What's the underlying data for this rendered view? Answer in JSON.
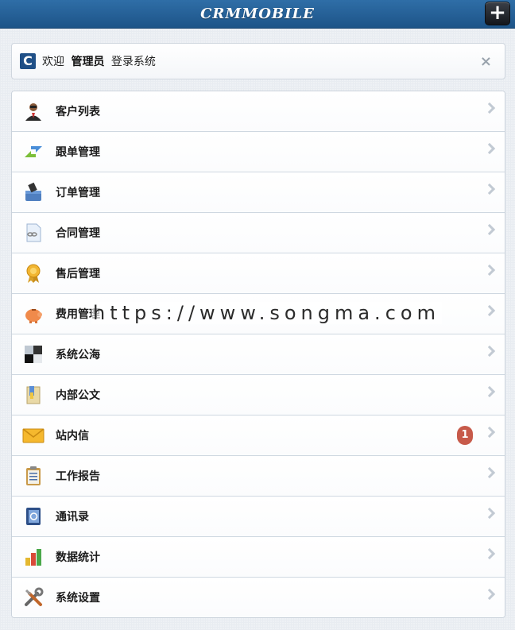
{
  "header": {
    "title": "CRMMOBILE",
    "add_label": "+"
  },
  "welcome": {
    "prefix": "欢迎",
    "role": "管理员",
    "suffix": "登录系统",
    "close": "×"
  },
  "menu": [
    {
      "label": "客户列表",
      "icon": "customer-icon"
    },
    {
      "label": "跟单管理",
      "icon": "follow-icon"
    },
    {
      "label": "订单管理",
      "icon": "order-icon"
    },
    {
      "label": "合同管理",
      "icon": "contract-icon"
    },
    {
      "label": "售后管理",
      "icon": "aftersale-icon"
    },
    {
      "label": "费用管理",
      "icon": "expense-icon"
    },
    {
      "label": "系统公海",
      "icon": "pool-icon"
    },
    {
      "label": "内部公文",
      "icon": "document-icon"
    },
    {
      "label": "站内信",
      "icon": "mail-icon",
      "badge": "1"
    },
    {
      "label": "工作报告",
      "icon": "report-icon"
    },
    {
      "label": "通讯录",
      "icon": "contacts-icon"
    },
    {
      "label": "数据统计",
      "icon": "stats-icon"
    },
    {
      "label": "系统设置",
      "icon": "settings-icon"
    }
  ],
  "watermark": "https://www.songma.com"
}
